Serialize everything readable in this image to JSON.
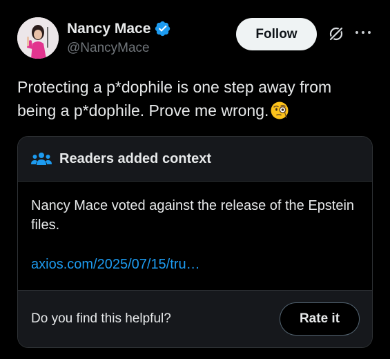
{
  "author": {
    "name": "Nancy Mace",
    "handle": "@NancyMace",
    "verified": true,
    "verified_color": "#1d9bf0"
  },
  "actions": {
    "follow_label": "Follow",
    "grok_icon": "grok-icon",
    "more_icon": "more-icon"
  },
  "post": {
    "text": "Protecting a p*dophile is one step away from being a p*dophile. Prove me wrong.",
    "emoji": "face-with-monocle-emoji"
  },
  "community_note": {
    "title": "Readers added context",
    "icon": "people-icon",
    "body": "Nancy Mace voted against the release of the Epstein files.",
    "link_text": "axios.com/2025/07/15/tru…",
    "helpful_question": "Do you find this helpful?",
    "rate_label": "Rate it"
  },
  "colors": {
    "background": "#000000",
    "text": "#e7e9ea",
    "secondary_text": "#71767b",
    "link": "#1d9bf0",
    "border": "#2f3336",
    "follow_bg": "#eff3f4"
  }
}
